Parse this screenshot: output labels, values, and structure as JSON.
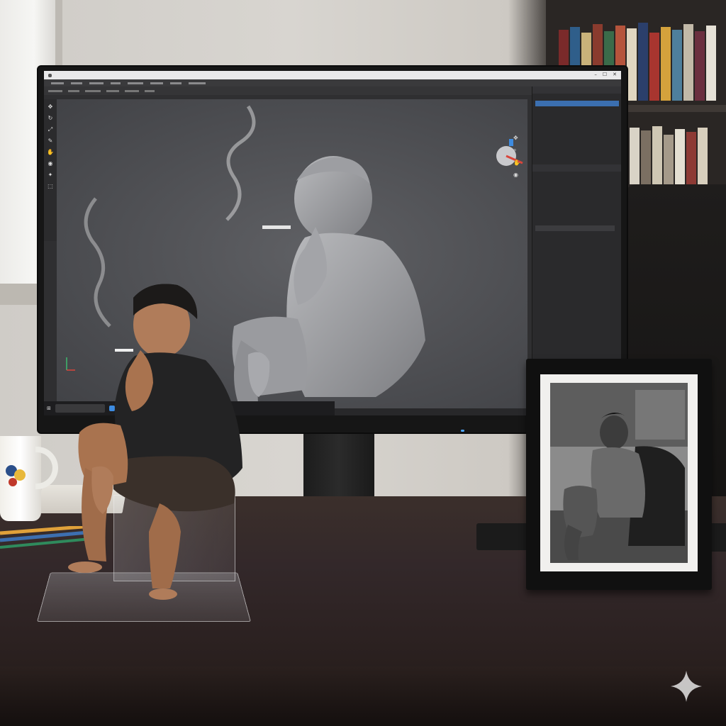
{
  "scene": {
    "description_free": true
  },
  "app": {
    "colors": {
      "viewport": "#55565a",
      "panel": "#2a2a2c",
      "selection": "#3b6fb0",
      "gizmo_red": "#d9453b",
      "gizmo_blue": "#3d8be0"
    },
    "icons": [
      "move-icon",
      "rotate-icon",
      "scale-icon",
      "brush-icon",
      "camera-icon",
      "light-icon",
      "hand-icon",
      "search-icon",
      "close-icon",
      "minimize-icon",
      "maximize-icon"
    ]
  },
  "brand": {
    "accent": "#3d8be0"
  }
}
